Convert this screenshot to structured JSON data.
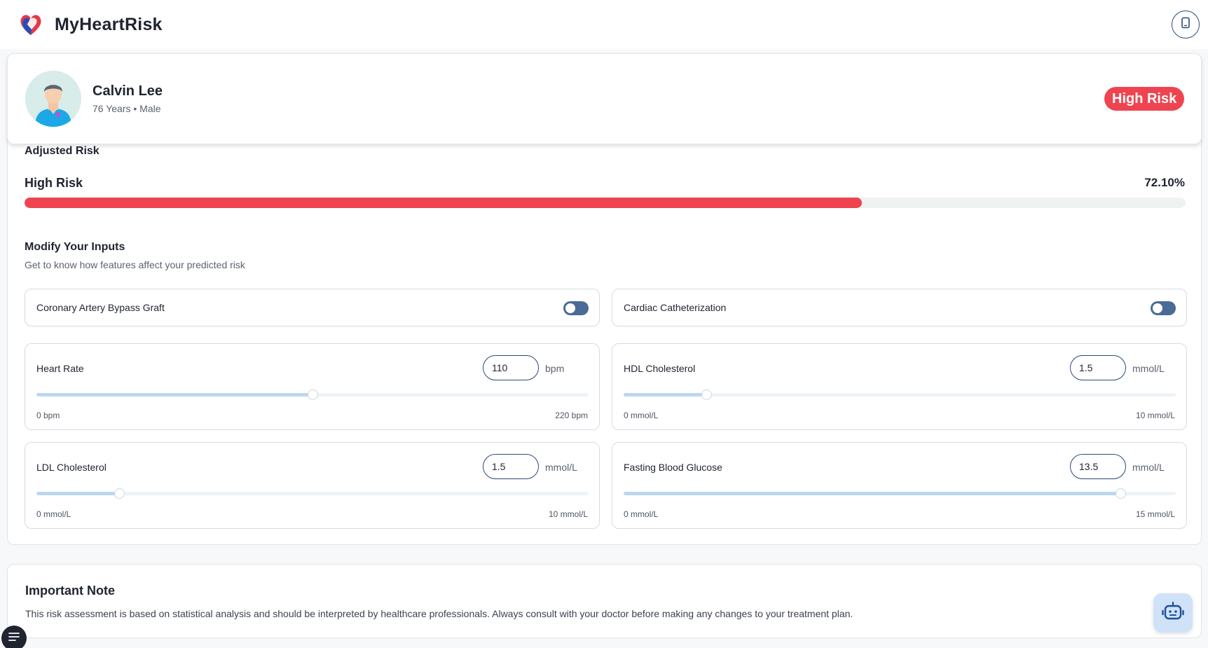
{
  "app": {
    "title": "MyHeartRisk"
  },
  "patient": {
    "name": "Calvin Lee",
    "details": "76 Years • Male",
    "risk_badge": "High Risk"
  },
  "adjusted_risk": {
    "section_label": "Adjusted Risk",
    "level": "High Risk",
    "percent_text": "72.10%",
    "percent_value": 72.1,
    "bar_color": "#ef4450"
  },
  "inputs": {
    "title": "Modify Your Inputs",
    "subtitle": "Get to know how features affect your predicted risk",
    "toggles": [
      {
        "label": "Coronary Artery Bypass Graft",
        "on": false
      },
      {
        "label": "Cardiac Catheterization",
        "on": false
      }
    ],
    "sliders": [
      {
        "label": "Heart Rate",
        "value": "110",
        "unit": "bpm",
        "min_label": "0 bpm",
        "max_label": "220 bpm",
        "min": 0,
        "max": 220
      },
      {
        "label": "HDL Cholesterol",
        "value": "1.5",
        "unit": "mmol/L",
        "min_label": "0 mmol/L",
        "max_label": "10 mmol/L",
        "min": 0,
        "max": 10
      },
      {
        "label": "LDL Cholesterol",
        "value": "1.5",
        "unit": "mmol/L",
        "min_label": "0 mmol/L",
        "max_label": "10 mmol/L",
        "min": 0,
        "max": 10
      },
      {
        "label": "Fasting Blood Glucose",
        "value": "13.5",
        "unit": "mmol/L",
        "min_label": "0 mmol/L",
        "max_label": "15 mmol/L",
        "min": 0,
        "max": 15
      }
    ]
  },
  "note": {
    "title": "Important Note",
    "text": "This risk assessment is based on statistical analysis and should be interpreted by healthcare professionals. Always consult with your doctor before making any changes to your treatment plan."
  },
  "icons": {
    "logo": "heart-logo-icon",
    "top_action": "tablet-icon",
    "bot": "robot-icon",
    "menu": "menu-icon"
  },
  "colors": {
    "high_risk": "#ef4450",
    "toggle": "#4a6b95",
    "slider_fill": "#bcd7f2",
    "accent": "#2a4a7a"
  }
}
